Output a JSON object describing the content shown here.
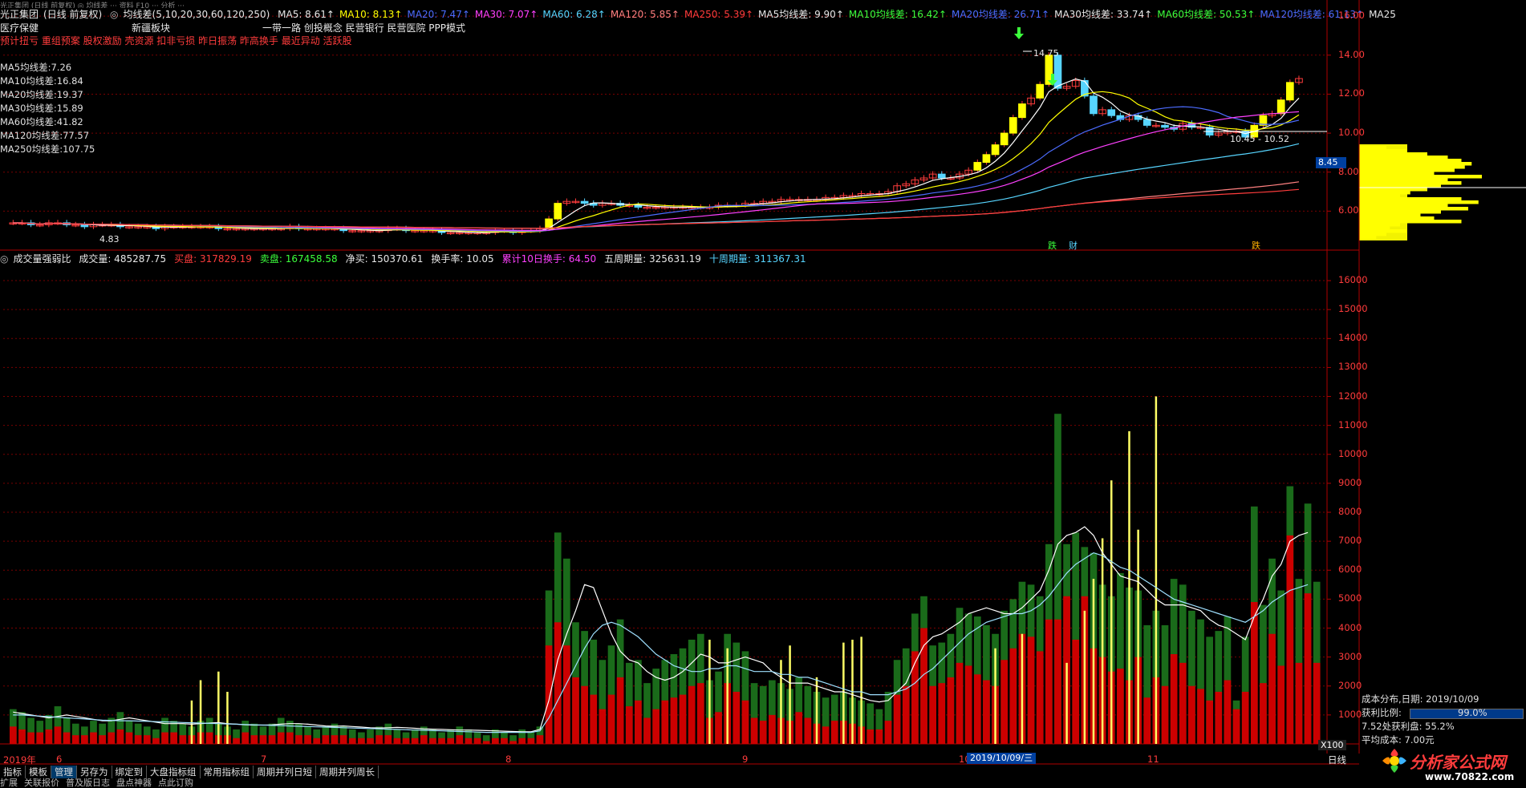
{
  "topbar": {
    "text": "光正集团 (日线 前复权) ◎ 均线差 ···  资料  F10  ···  分析  ···"
  },
  "header": {
    "stock_name": "光正集团",
    "period": "(日线 前复权)",
    "indicator": "均线差(5,10,20,30,60,120,250)",
    "ma_values": [
      {
        "label": "MA5: 8.61",
        "color": "#e8e8e8"
      },
      {
        "label": "MA10: 8.13",
        "color": "#ffff00"
      },
      {
        "label": "MA20: 7.47",
        "color": "#4c6cff"
      },
      {
        "label": "MA30: 7.07",
        "color": "#ff40ff"
      },
      {
        "label": "MA60: 6.28",
        "color": "#57d5ff"
      },
      {
        "label": "MA120: 5.85",
        "color": "#ff8080"
      },
      {
        "label": "MA250: 5.39",
        "color": "#ff3c3c"
      },
      {
        "label": "MA5均线差: 9.90",
        "color": "#e8e8e8"
      },
      {
        "label": "MA10均线差: 16.42",
        "color": "#3cff3c"
      },
      {
        "label": "MA20均线差: 26.71",
        "color": "#4c6cff"
      },
      {
        "label": "MA30均线差: 33.74",
        "color": "#e8e8e8"
      },
      {
        "label": "MA60均线差: 50.53",
        "color": "#3cff3c"
      },
      {
        "label": "MA120均线差: 61.13",
        "color": "#4c6cff"
      },
      {
        "label": "MA25",
        "color": "#e8e8e8"
      }
    ]
  },
  "concepts": {
    "row1": [
      "医疗保健",
      "新疆板块",
      "一带一路 创投概念 民营银行 民营医院 PPP模式"
    ],
    "row2": "预计扭亏 重组预案 股权激励 壳资源 扣非亏损 昨日振荡 昨高换手 最近异动 活跃股"
  },
  "ma_diff_list": [
    "MA5均线差:7.26",
    "MA10均线差:16.84",
    "MA20均线差:19.37",
    "MA30均线差:15.89",
    "MA60均线差:41.82",
    "MA120均线差:77.57",
    "MA250均线差:107.75"
  ],
  "price_annotations": {
    "high": "14.75",
    "low": "4.83",
    "range": "10.45 - 10.52",
    "current_price_tag": "8.45",
    "event_labels": [
      "跌",
      "财",
      "跌"
    ]
  },
  "price_axis": [
    "16.00",
    "14.00",
    "12.00",
    "10.00",
    "8.00",
    "6.00"
  ],
  "volume_header": {
    "title": "成交量强弱比",
    "items": [
      {
        "label": "成交量: 485287.75",
        "color": "#e8e8e8"
      },
      {
        "label": "买盘: 317829.19",
        "color": "#ff3c3c"
      },
      {
        "label": "卖盘: 167458.58",
        "color": "#3cff3c"
      },
      {
        "label": "净买: 150370.61",
        "color": "#e8e8e8"
      },
      {
        "label": "换手率: 10.05",
        "color": "#e8e8e8"
      },
      {
        "label": "累计10日换手: 64.50",
        "color": "#ff40ff"
      },
      {
        "label": "五周期量: 325631.19",
        "color": "#e8e8e8"
      },
      {
        "label": "十周期量: 311367.31",
        "color": "#57d5ff"
      }
    ]
  },
  "volume_axis": [
    "16000",
    "15000",
    "14000",
    "13000",
    "12000",
    "11000",
    "10000",
    "9000",
    "8000",
    "7000",
    "6000",
    "5000",
    "4000",
    "3000",
    "2000",
    "1000"
  ],
  "volume_unit": "X100",
  "time_axis": [
    "2019年",
    "6",
    "7",
    "8",
    "9",
    "10",
    "11"
  ],
  "time_cursor": "2019/10/09/三",
  "period_label": "日线",
  "tabs": [
    "指标",
    "模板",
    "管理",
    "另存为",
    "绑定到",
    "大盘指标组",
    "常用指标组",
    "周期并列日短",
    "周期并列周长"
  ],
  "active_tab": "管理",
  "tabs2": [
    "扩展",
    "关联报价",
    "普及版日志",
    "盘点神器",
    "点此订购"
  ],
  "cost_panel": {
    "title": "成本分布,日期: 2019/10/09",
    "profit_label": "获利比例:",
    "profit_value": "99.0%",
    "profit_line": "7.52处获利盘: 55.2%",
    "avg_cost": "平均成本: 7.00元"
  },
  "logo": {
    "text": "分析家公式网",
    "url": "www.70822.com"
  },
  "colors": {
    "up": "#ff3c3c",
    "down": "#57d5ff",
    "vol_up": "#cc0000",
    "vol_down": "#1a6b1a",
    "grid": "#7a0000",
    "axis": "#b00000"
  },
  "chart_data": {
    "type": "bar",
    "title": "成交量强弱比",
    "ylabel": "X100",
    "ylim": [
      0,
      16500
    ],
    "series": [
      {
        "name": "成交量",
        "values": [
          1200,
          1100,
          900,
          800,
          1000,
          1300,
          900,
          700,
          600,
          800,
          700,
          900,
          1100,
          800,
          700,
          600,
          500,
          900,
          800,
          700,
          600,
          800,
          900,
          700,
          600,
          500,
          800,
          700,
          600,
          700,
          900,
          800,
          700,
          600,
          500,
          600,
          700,
          600,
          500,
          400,
          500,
          600,
          700,
          500,
          400,
          500,
          600,
          500,
          400,
          500,
          600,
          500,
          400,
          300,
          500,
          400,
          300,
          500,
          400,
          600,
          5300,
          7300,
          6400,
          4200,
          3900,
          3600,
          2900,
          3400,
          4300,
          2800,
          2900,
          2100,
          2600,
          2900,
          3100,
          3300,
          3600,
          3800,
          2200,
          2500,
          3800,
          3500,
          3200,
          2100,
          2000,
          2200,
          2100,
          1900,
          2300,
          2000,
          1800,
          1600,
          1700,
          1800,
          1600,
          1500,
          1400,
          1200,
          1800,
          2900,
          3300,
          4500,
          5100,
          3400,
          3500,
          3800,
          4700,
          4500,
          4400,
          4100,
          3800,
          4600,
          5000,
          5600,
          5500,
          5100,
          6900,
          11400,
          6900,
          7300,
          6800,
          6600,
          5500,
          5100,
          5900,
          5400,
          5300,
          4100,
          4600,
          4100,
          5700,
          5500,
          4600,
          4300,
          3700,
          3900,
          4400,
          1500,
          3700,
          8200,
          4800,
          6400,
          5300,
          8900,
          5700,
          8300,
          5600
        ]
      },
      {
        "name": "买盘",
        "values": [
          600,
          500,
          400,
          400,
          500,
          600,
          400,
          300,
          300,
          400,
          300,
          400,
          500,
          400,
          300,
          300,
          200,
          400,
          400,
          300,
          300,
          400,
          400,
          300,
          300,
          200,
          400,
          300,
          300,
          300,
          400,
          400,
          300,
          300,
          200,
          300,
          300,
          300,
          200,
          200,
          200,
          300,
          300,
          200,
          200,
          200,
          300,
          200,
          200,
          200,
          300,
          200,
          200,
          100,
          200,
          200,
          100,
          200,
          200,
          300,
          3400,
          4200,
          3400,
          2300,
          2000,
          1700,
          1200,
          1700,
          2300,
          1300,
          1500,
          900,
          1200,
          1500,
          1600,
          1700,
          2000,
          2100,
          900,
          1100,
          2100,
          1800,
          1500,
          900,
          800,
          1000,
          900,
          800,
          1100,
          900,
          700,
          600,
          800,
          800,
          700,
          600,
          500,
          500,
          800,
          1700,
          2000,
          3200,
          4000,
          2000,
          2100,
          2300,
          2800,
          2700,
          2400,
          2200,
          2000,
          2900,
          3300,
          3800,
          3700,
          3200,
          4300,
          4300,
          5100,
          3600,
          5100,
          3300,
          3000,
          2500,
          2600,
          2200,
          3000,
          1600,
          2300,
          2000,
          3100,
          2800,
          2000,
          1900,
          1500,
          1800,
          2200,
          1200,
          1800,
          4900,
          2100,
          3800,
          2700,
          7200,
          2800,
          5200,
          2800
        ]
      },
      {
        "name": "五周期量",
        "values": [
          1100,
          1050,
          1000,
          950,
          900,
          950,
          1000,
          950,
          900,
          850,
          800,
          800,
          850,
          900,
          850,
          800,
          750,
          700,
          700,
          700,
          680,
          700,
          720,
          740,
          700,
          680,
          660,
          650,
          650,
          660,
          680,
          700,
          700,
          680,
          650,
          620,
          610,
          620,
          600,
          580,
          560,
          550,
          560,
          570,
          560,
          540,
          520,
          510,
          500,
          490,
          480,
          480,
          470,
          460,
          450,
          440,
          430,
          420,
          420,
          500,
          1500,
          2900,
          3800,
          4600,
          5500,
          5400,
          4600,
          3800,
          3200,
          2900,
          2800,
          2500,
          2300,
          2200,
          2300,
          2500,
          2800,
          3100,
          3000,
          2800,
          2800,
          2900,
          3000,
          2900,
          2800,
          2500,
          2300,
          2100,
          2100,
          2100,
          2000,
          1900,
          1800,
          1800,
          1700,
          1600,
          1500,
          1450,
          1500,
          1800,
          2100,
          2800,
          3400,
          3700,
          3800,
          4000,
          4200,
          4500,
          4600,
          4700,
          4600,
          4500,
          4500,
          4700,
          5000,
          5300,
          6000,
          6900,
          7200,
          7300,
          7500,
          7200,
          6600,
          6200,
          5800,
          5700,
          5600,
          5300,
          5000,
          4800,
          4800,
          4800,
          4700,
          4600,
          4300,
          4100,
          4000,
          3800,
          3600,
          4400,
          5000,
          5800,
          6200,
          7000,
          7200,
          7300
        ]
      },
      {
        "name": "十周期量",
        "values": [
          1000,
          1000,
          980,
          960,
          940,
          920,
          900,
          880,
          860,
          840,
          820,
          810,
          800,
          800,
          790,
          780,
          770,
          760,
          750,
          740,
          730,
          720,
          710,
          700,
          690,
          680,
          670,
          660,
          650,
          640,
          630,
          620,
          610,
          600,
          590,
          580,
          570,
          560,
          550,
          540,
          530,
          520,
          510,
          500,
          490,
          480,
          470,
          460,
          450,
          440,
          430,
          420,
          410,
          400,
          400,
          400,
          400,
          400,
          400,
          450,
          900,
          1500,
          2100,
          2700,
          3300,
          3800,
          4100,
          4200,
          4100,
          3900,
          3700,
          3400,
          3100,
          2900,
          2700,
          2600,
          2500,
          2500,
          2600,
          2600,
          2700,
          2700,
          2600,
          2500,
          2500,
          2500,
          2400,
          2400,
          2300,
          2300,
          2200,
          2100,
          2000,
          1900,
          1800,
          1800,
          1700,
          1700,
          1700,
          1800,
          1900,
          2100,
          2400,
          2600,
          2900,
          3200,
          3500,
          3800,
          4000,
          4200,
          4300,
          4400,
          4500,
          4500,
          4600,
          4800,
          5100,
          5500,
          5900,
          6200,
          6400,
          6600,
          6500,
          6300,
          6100,
          6000,
          5800,
          5600,
          5400,
          5200,
          5000,
          4900,
          4800,
          4700,
          4600,
          4500,
          4400,
          4300,
          4200,
          4400,
          4600,
          4900,
          5100,
          5300,
          5400,
          5500
        ]
      }
    ],
    "price_ylim": [
      4.0,
      16.5
    ],
    "price_close": [
      5.4,
      5.4,
      5.3,
      5.3,
      5.4,
      5.4,
      5.3,
      5.3,
      5.2,
      5.3,
      5.3,
      5.3,
      5.2,
      5.2,
      5.2,
      5.2,
      5.1,
      5.2,
      5.2,
      5.2,
      5.2,
      5.2,
      5.2,
      5.1,
      5.1,
      5.1,
      5.1,
      5.1,
      5.1,
      5.1,
      5.1,
      5.2,
      5.1,
      5.1,
      5.1,
      5.1,
      5.1,
      5.0,
      5.0,
      5.0,
      5.0,
      5.0,
      5.1,
      5.1,
      5.0,
      5.0,
      5.0,
      5.0,
      4.9,
      4.9,
      4.9,
      4.9,
      4.9,
      4.9,
      5.0,
      5.0,
      4.9,
      5.0,
      5.0,
      5.1,
      5.6,
      6.4,
      6.5,
      6.5,
      6.4,
      6.3,
      6.4,
      6.4,
      6.3,
      6.3,
      6.2,
      6.2,
      6.2,
      6.2,
      6.2,
      6.2,
      6.2,
      6.2,
      6.2,
      6.3,
      6.3,
      6.3,
      6.4,
      6.4,
      6.5,
      6.5,
      6.6,
      6.6,
      6.6,
      6.6,
      6.6,
      6.7,
      6.7,
      6.8,
      6.8,
      6.9,
      6.9,
      6.9,
      7.0,
      7.3,
      7.4,
      7.6,
      7.7,
      7.9,
      7.7,
      7.7,
      7.9,
      8.1,
      8.5,
      8.9,
      9.4,
      10.0,
      10.8,
      11.5,
      11.8,
      12.5,
      14.0,
      12.3,
      12.4,
      12.7,
      11.9,
      11.0,
      11.2,
      10.9,
      10.7,
      10.9,
      10.7,
      10.4,
      10.4,
      10.3,
      10.2,
      10.5,
      10.3,
      10.3,
      9.9,
      10.0,
      10.1,
      10.1,
      9.8,
      10.4,
      10.9,
      11.0,
      11.7,
      12.6,
      12.8
    ]
  }
}
